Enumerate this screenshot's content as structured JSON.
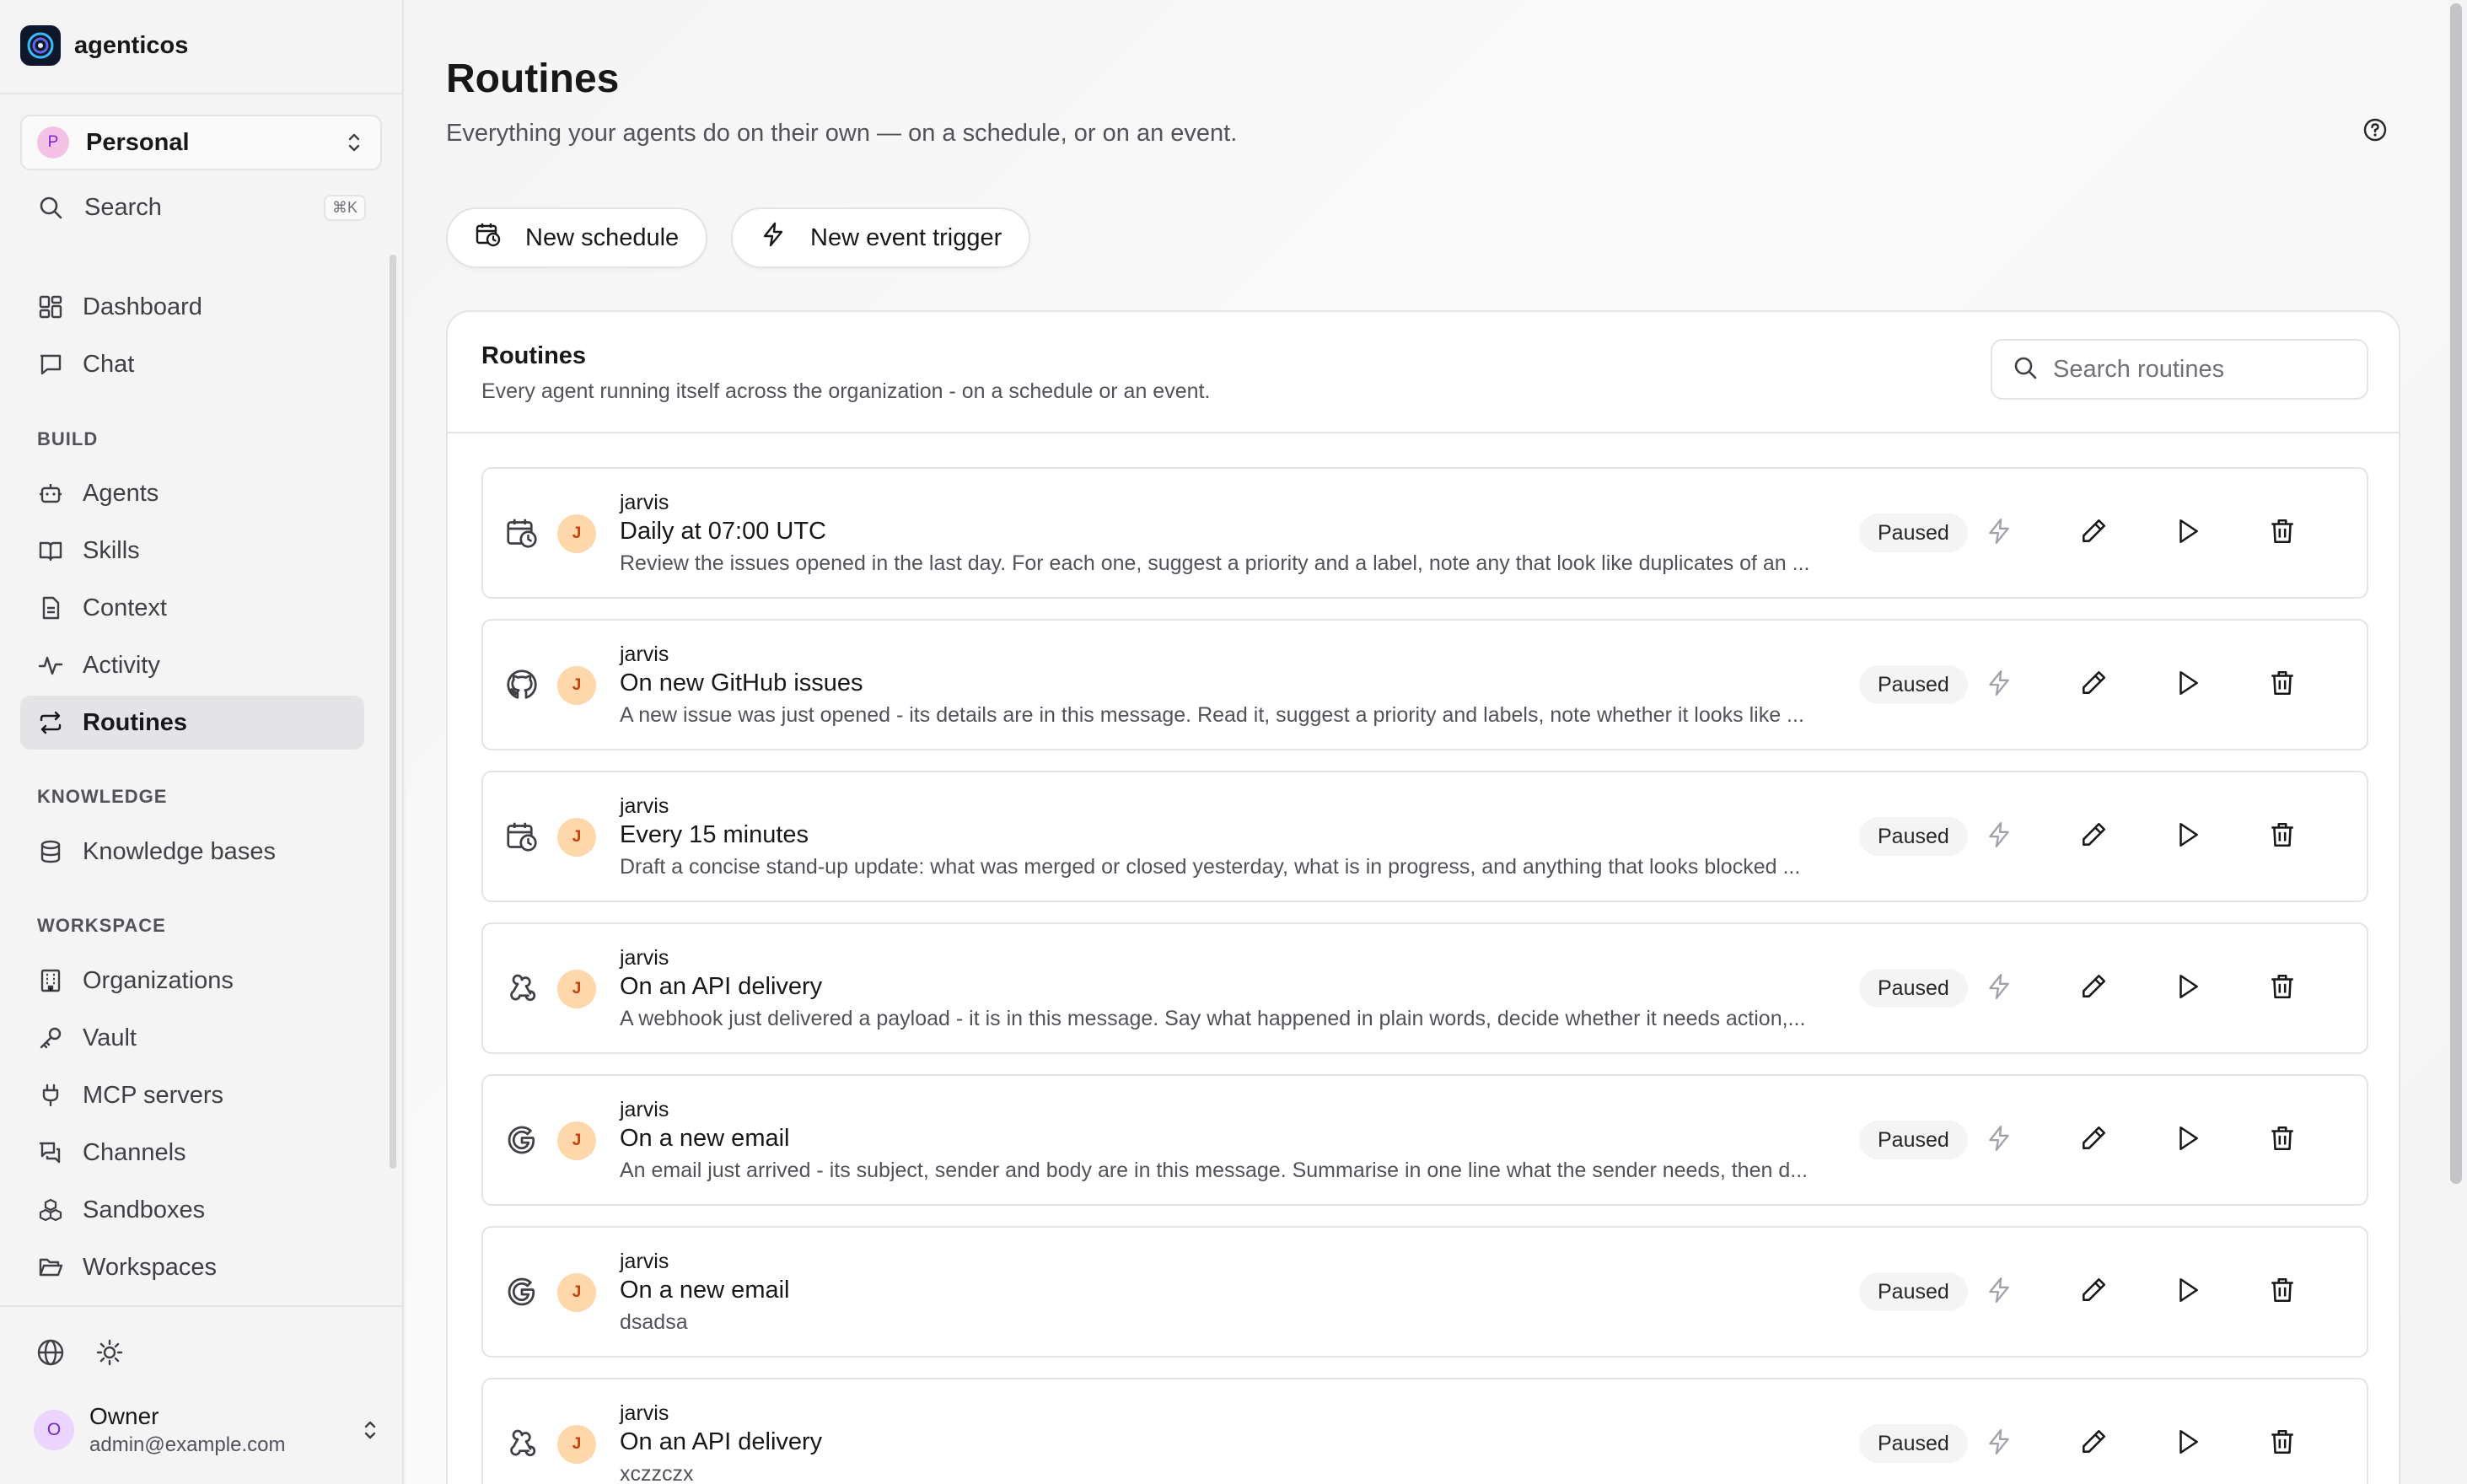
{
  "brand": {
    "name": "agenticos"
  },
  "org_selector": {
    "initial": "P",
    "name": "Personal"
  },
  "search": {
    "label": "Search",
    "shortcut": "⌘K"
  },
  "nav": {
    "dashboard": "Dashboard",
    "chat": "Chat",
    "build_label": "BUILD",
    "agents": "Agents",
    "skills": "Skills",
    "context": "Context",
    "activity": "Activity",
    "routines": "Routines",
    "knowledge_label": "KNOWLEDGE",
    "knowledge_bases": "Knowledge bases",
    "workspace_label": "WORKSPACE",
    "organizations": "Organizations",
    "vault": "Vault",
    "mcp_servers": "MCP servers",
    "channels": "Channels",
    "sandboxes": "Sandboxes",
    "workspaces": "Workspaces"
  },
  "user": {
    "initial": "O",
    "name": "Owner",
    "email": "admin@example.com"
  },
  "page": {
    "title": "Routines",
    "subtitle": "Everything your agents do on their own — on a schedule, or on an event.",
    "new_schedule": "New schedule",
    "new_event_trigger": "New event trigger"
  },
  "panel": {
    "title": "Routines",
    "subtitle": "Every agent running itself across the organization - on a schedule or an event.",
    "search_placeholder": "Search routines"
  },
  "routines": [
    {
      "type_icon": "calendar-clock-icon",
      "avatar": "J",
      "agent": "jarvis",
      "title": "Daily at 07:00 UTC",
      "description": "Review the issues opened in the last day. For each one, suggest a priority and a label, note any that look like duplicates of an ...",
      "status": "Paused"
    },
    {
      "type_icon": "github-icon",
      "avatar": "J",
      "agent": "jarvis",
      "title": "On new GitHub issues",
      "description": "A new issue was just opened - its details are in this message. Read it, suggest a priority and labels, note whether it looks like ...",
      "status": "Paused"
    },
    {
      "type_icon": "calendar-clock-icon",
      "avatar": "J",
      "agent": "jarvis",
      "title": "Every 15 minutes",
      "description": "Draft a concise stand-up update: what was merged or closed yesterday, what is in progress, and anything that looks blocked ...",
      "status": "Paused"
    },
    {
      "type_icon": "webhook-icon",
      "avatar": "J",
      "agent": "jarvis",
      "title": "On an API delivery",
      "description": "A webhook just delivered a payload - it is in this message. Say what happened in plain words, decide whether it needs action,...",
      "status": "Paused"
    },
    {
      "type_icon": "google-icon",
      "avatar": "J",
      "agent": "jarvis",
      "title": "On a new email",
      "description": "An email just arrived - its subject, sender and body are in this message. Summarise in one line what the sender needs, then d...",
      "status": "Paused"
    },
    {
      "type_icon": "google-icon",
      "avatar": "J",
      "agent": "jarvis",
      "title": "On a new email",
      "description": "dsadsa",
      "status": "Paused"
    },
    {
      "type_icon": "webhook-icon",
      "avatar": "J",
      "agent": "jarvis",
      "title": "On an API delivery",
      "description": "xczzczx",
      "status": "Paused"
    }
  ]
}
